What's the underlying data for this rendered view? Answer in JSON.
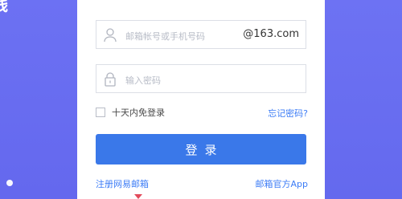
{
  "background": {
    "heading_fragment": "线"
  },
  "form": {
    "email": {
      "placeholder": "邮箱帐号或手机号码",
      "suffix": "@163.com",
      "icon": "user-icon"
    },
    "password": {
      "placeholder": "输入密码",
      "icon": "lock-icon"
    },
    "remember_label": "十天内免登录",
    "forgot_link": "忘记密码?",
    "login_button": "登录",
    "register_link": "注册网易邮箱",
    "app_link": "邮箱官方App"
  },
  "colors": {
    "background": "#6a6ff2",
    "primary_button": "#3a78e9",
    "link": "#3c7cf6"
  }
}
